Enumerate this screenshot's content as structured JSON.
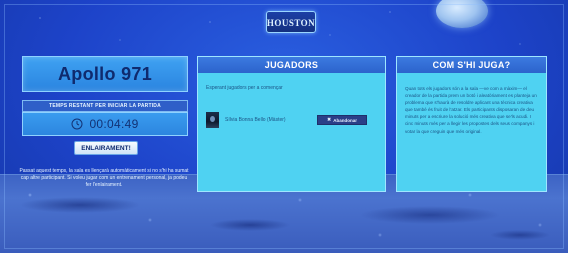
{
  "logo": {
    "text": "HOUSTON"
  },
  "mission": {
    "title": "Apollo 971"
  },
  "timer": {
    "header": "TEMPS RESTANT PER INICIAR LA PARTIDA",
    "value": "00:04:49"
  },
  "launch_button": {
    "label": "ENLAIRAMENT!"
  },
  "notice": "Passat aquest temps, la sala es llençarà automàticament si no s'hi ha sumat cap altre participant. Si voleu jugar com un entrenament personal, ja podeu fer l'enlairament.",
  "players_panel": {
    "title": "JUGADORS",
    "waiting_text": "Esperant jugadors per a començar",
    "players": [
      {
        "name": "Sílvia Bonna Bello (Màster)",
        "action_label": "Abandonar"
      }
    ]
  },
  "rules_panel": {
    "title": "COM S'HI JUGA?",
    "body": "Quan tots els jugadors són a la sala —ve com a màxim— el creador de la partida prem un botó i aleatòriament es planteja un problema que s'haurà de resoldre aplicant una tècnica creativa que també és fruit de l'atzar. Els participants disposaran de deu minuts per a escriure la solució més creativa que se'ls acudi. I cinc minuts més per a llegir les propostes dels seus companys i votar la que creguin que més original."
  },
  "colors": {
    "background": "#1d43c9",
    "panel_bg": "#4fd2f2",
    "panel_header": "#2c63cc",
    "mission_box": "#3fa2f2"
  }
}
